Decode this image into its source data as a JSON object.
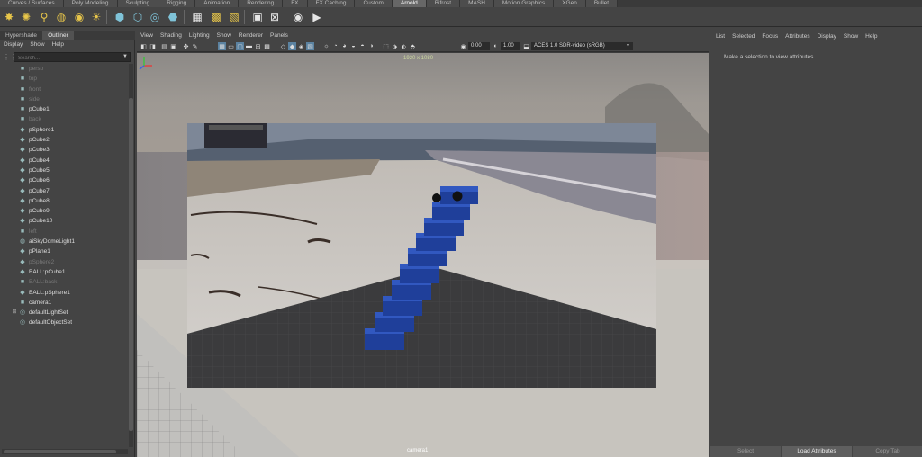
{
  "shelf": {
    "tabs": [
      {
        "label": "Curves / Surfaces",
        "active": false
      },
      {
        "label": "Poly Modeling",
        "active": false
      },
      {
        "label": "Sculpting",
        "active": false
      },
      {
        "label": "Rigging",
        "active": false
      },
      {
        "label": "Animation",
        "active": false
      },
      {
        "label": "Rendering",
        "active": false
      },
      {
        "label": "FX",
        "active": false
      },
      {
        "label": "FX Caching",
        "active": false
      },
      {
        "label": "Custom",
        "active": false
      },
      {
        "label": "Arnold",
        "active": true
      },
      {
        "label": "Bifrost",
        "active": false
      },
      {
        "label": "MASH",
        "active": false
      },
      {
        "label": "Motion Graphics",
        "active": false
      },
      {
        "label": "XGen",
        "active": false
      },
      {
        "label": "Bullet",
        "active": false
      }
    ],
    "icons": [
      {
        "name": "area-light-icon",
        "glyph": "✸",
        "tone": "yellow"
      },
      {
        "name": "mesh-light-icon",
        "glyph": "✺",
        "tone": "yellow"
      },
      {
        "name": "spot-light-icon",
        "glyph": "⚲",
        "tone": "yellow"
      },
      {
        "name": "skydome-light-icon",
        "glyph": "◍",
        "tone": "yellow"
      },
      {
        "name": "photometric-light-icon",
        "glyph": "◉",
        "tone": "yellow"
      },
      {
        "name": "physical-sky-icon",
        "glyph": "☀",
        "tone": "yellow"
      },
      {
        "name": "standin-icon",
        "glyph": "⬢",
        "tone": "cyan"
      },
      {
        "name": "export-standin-icon",
        "glyph": "⬡",
        "tone": "cyan"
      },
      {
        "name": "volume-icon",
        "glyph": "◎",
        "tone": "cyan"
      },
      {
        "name": "shader-ball-icon",
        "glyph": "⬣",
        "tone": "cyan"
      },
      {
        "name": "flush-cache-icon",
        "glyph": "▦",
        "tone": "white"
      },
      {
        "name": "tx-manager-icon",
        "glyph": "▩",
        "tone": "yellow"
      },
      {
        "name": "license-icon",
        "glyph": "▧",
        "tone": "yellow"
      },
      {
        "name": "arnold-render-icon",
        "glyph": "▣",
        "tone": "white"
      },
      {
        "name": "arnold-ipr-icon",
        "glyph": "⊠",
        "tone": "white"
      },
      {
        "name": "render-view-icon",
        "glyph": "◉",
        "tone": "white"
      },
      {
        "name": "playblast-icon",
        "glyph": "▶",
        "tone": "white"
      }
    ]
  },
  "left_panel": {
    "tabs": [
      {
        "label": "Hypershade",
        "active": false
      },
      {
        "label": "Outliner",
        "active": true
      }
    ],
    "menu": [
      "Display",
      "Show",
      "Help"
    ],
    "search": {
      "placeholder": "Search..."
    },
    "items": [
      {
        "label": "persp",
        "icon": "camera",
        "dim": true,
        "expander": ""
      },
      {
        "label": "top",
        "icon": "camera",
        "dim": true,
        "expander": ""
      },
      {
        "label": "front",
        "icon": "camera",
        "dim": true,
        "expander": ""
      },
      {
        "label": "side",
        "icon": "camera",
        "dim": true,
        "expander": ""
      },
      {
        "label": "pCube1",
        "icon": "camera",
        "dim": false,
        "expander": ""
      },
      {
        "label": "back",
        "icon": "camera",
        "dim": true,
        "expander": ""
      },
      {
        "label": "pSphere1",
        "icon": "mesh",
        "dim": false,
        "expander": ""
      },
      {
        "label": "pCube2",
        "icon": "mesh",
        "dim": false,
        "expander": ""
      },
      {
        "label": "pCube3",
        "icon": "mesh",
        "dim": false,
        "expander": ""
      },
      {
        "label": "pCube4",
        "icon": "mesh",
        "dim": false,
        "expander": ""
      },
      {
        "label": "pCube5",
        "icon": "mesh",
        "dim": false,
        "expander": ""
      },
      {
        "label": "pCube6",
        "icon": "mesh",
        "dim": false,
        "expander": ""
      },
      {
        "label": "pCube7",
        "icon": "mesh",
        "dim": false,
        "expander": ""
      },
      {
        "label": "pCube8",
        "icon": "mesh",
        "dim": false,
        "expander": ""
      },
      {
        "label": "pCube9",
        "icon": "mesh",
        "dim": false,
        "expander": ""
      },
      {
        "label": "pCube10",
        "icon": "mesh",
        "dim": false,
        "expander": ""
      },
      {
        "label": "left",
        "icon": "camera",
        "dim": true,
        "expander": ""
      },
      {
        "label": "aiSkyDomeLight1",
        "icon": "light",
        "dim": false,
        "expander": ""
      },
      {
        "label": "pPlane1",
        "icon": "mesh",
        "dim": false,
        "expander": ""
      },
      {
        "label": "pSphere2",
        "icon": "mesh",
        "dim": true,
        "expander": ""
      },
      {
        "label": "BALL:pCube1",
        "icon": "mesh",
        "dim": false,
        "expander": ""
      },
      {
        "label": "BALL:back",
        "icon": "camera",
        "dim": true,
        "expander": ""
      },
      {
        "label": "BALL:pSphere1",
        "icon": "mesh",
        "dim": false,
        "expander": ""
      },
      {
        "label": "camera1",
        "icon": "camera",
        "dim": false,
        "expander": ""
      },
      {
        "label": "defaultLightSet",
        "icon": "set",
        "dim": false,
        "expander": "⊞"
      },
      {
        "label": "defaultObjectSet",
        "icon": "set",
        "dim": false,
        "expander": ""
      }
    ]
  },
  "viewport": {
    "menu": [
      "View",
      "Shading",
      "Lighting",
      "Show",
      "Renderer",
      "Panels"
    ],
    "exposure_value": "0.00",
    "gamma_value": "1.00",
    "colorspace": "ACES 1.0 SDR-video (sRGB)",
    "resolution": "1920 x 1080",
    "camera_name": "camera1"
  },
  "attribute_editor": {
    "menu": [
      "List",
      "Selected",
      "Focus",
      "Attributes",
      "Display",
      "Show",
      "Help"
    ],
    "hint": "Make a selection to view attributes",
    "buttons": {
      "select": "Select",
      "load": "Load Attributes",
      "copy": "Copy Tab"
    }
  }
}
